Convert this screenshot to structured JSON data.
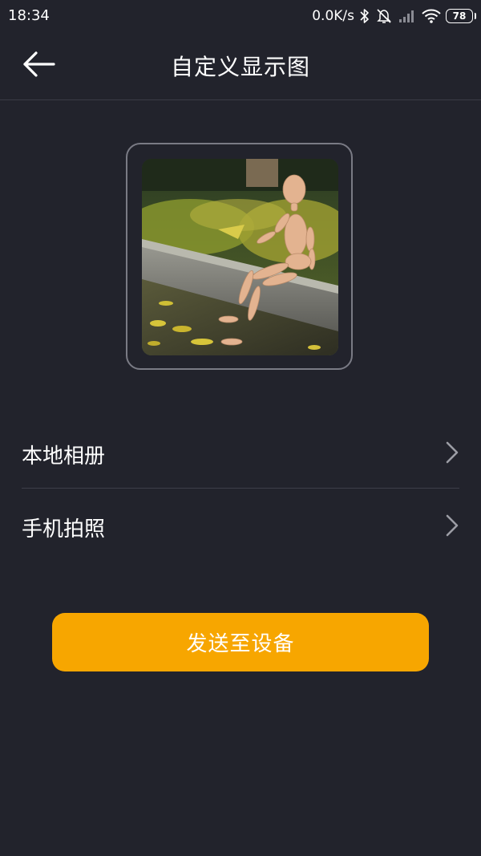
{
  "status_bar": {
    "time": "18:34",
    "net_speed": "0.0K/s",
    "battery": "78",
    "icons": [
      "bluetooth-icon",
      "mute-icon",
      "cellular-signal-icon",
      "wifi-icon",
      "battery-icon"
    ]
  },
  "nav": {
    "title": "自定义显示图",
    "back_icon": "arrow-left-icon"
  },
  "preview": {
    "description_icon": "preview-photo"
  },
  "menu": {
    "items": [
      {
        "label": "本地相册",
        "icon": "chevron-right-icon"
      },
      {
        "label": "手机拍照",
        "icon": "chevron-right-icon"
      }
    ]
  },
  "actions": {
    "send_label": "发送至设备"
  },
  "colors": {
    "background": "#22232c",
    "accent": "#f7a600",
    "divider": "#3e3f49",
    "frame_border": "#7a7b85"
  }
}
